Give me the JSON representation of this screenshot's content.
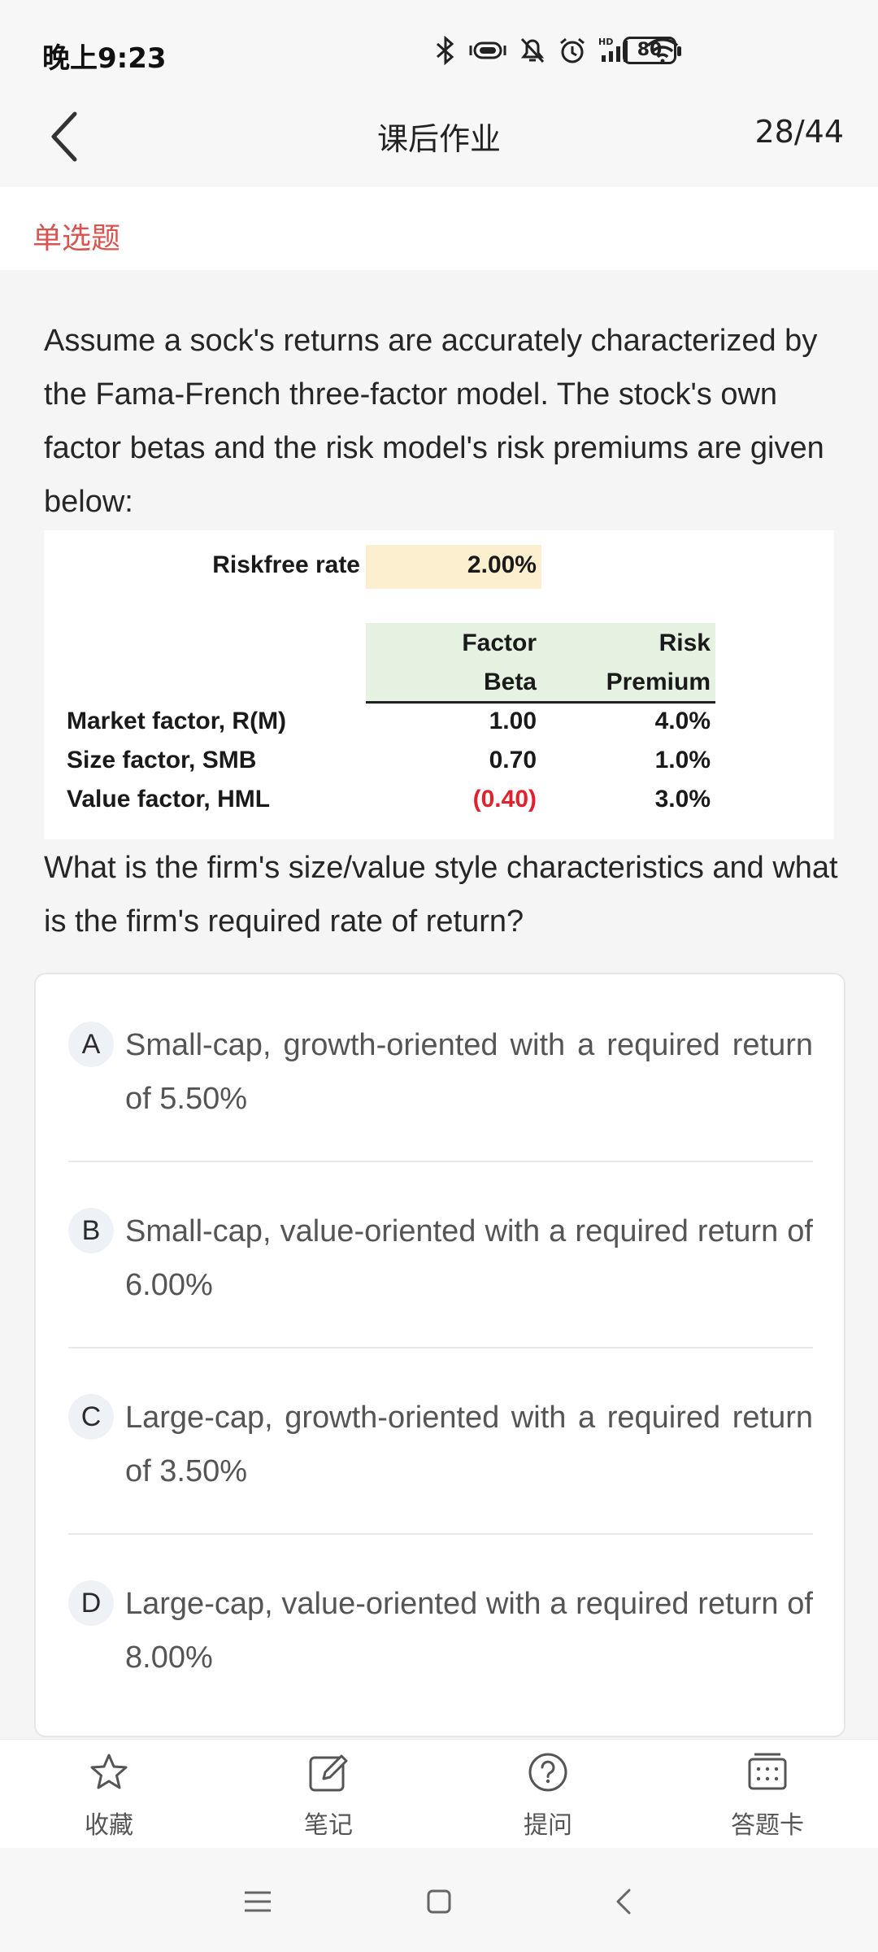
{
  "status_bar": {
    "time": "晚上9:23",
    "battery": "80",
    "icons": [
      "bluetooth-icon",
      "vibrate-icon",
      "mute-bell-icon",
      "alarm-icon",
      "hd-signal-icon",
      "wifi-icon",
      "battery-icon"
    ]
  },
  "header": {
    "title": "课后作业",
    "progress": "28/44",
    "back_icon": "chevron-left-icon"
  },
  "question": {
    "type": "单选题",
    "intro": "Assume a sock's returns are accurately characterized by the Fama-French three-factor model. The stock's own factor betas and the risk model's risk premiums are given below:",
    "prompt": "What is the firm's size/value style characteristics and what is the firm's required rate of return?",
    "table": {
      "riskfree_label": "Riskfree rate",
      "riskfree_value": "2.00%",
      "col1_line1": "Factor",
      "col1_line2": "Beta",
      "col2_line1": "Risk",
      "col2_line2": "Premium",
      "rows": [
        {
          "label": "Market factor, R(M)",
          "beta": "1.00",
          "premium": "4.0%"
        },
        {
          "label": "Size factor, SMB",
          "beta": "0.70",
          "premium": "1.0%"
        },
        {
          "label": "Value factor, HML",
          "beta": "(0.40)",
          "premium": "3.0%"
        }
      ],
      "negative_color": "#e0222e"
    }
  },
  "options": [
    {
      "letter": "A",
      "text": "Small-cap, growth-oriented with a required return of 5.50%"
    },
    {
      "letter": "B",
      "text": "Small-cap, value-oriented with a required return of 6.00%"
    },
    {
      "letter": "C",
      "text": "Large-cap, growth-oriented with a required return of 3.50%"
    },
    {
      "letter": "D",
      "text": "Large-cap, value-oriented with a required return of 8.00%"
    }
  ],
  "bottom_tabs": [
    {
      "label": "收藏",
      "icon": "star-icon"
    },
    {
      "label": "笔记",
      "icon": "note-edit-icon"
    },
    {
      "label": "提问",
      "icon": "question-icon"
    },
    {
      "label": "答题卡",
      "icon": "answer-card-icon"
    }
  ],
  "nav_bar": {
    "icons": [
      "menu-icon",
      "home-icon",
      "back-icon"
    ]
  },
  "colors": {
    "accent": "#d9534f",
    "riskfree_highlight": "#fcefd0",
    "header_highlight": "#e5f2e1"
  }
}
